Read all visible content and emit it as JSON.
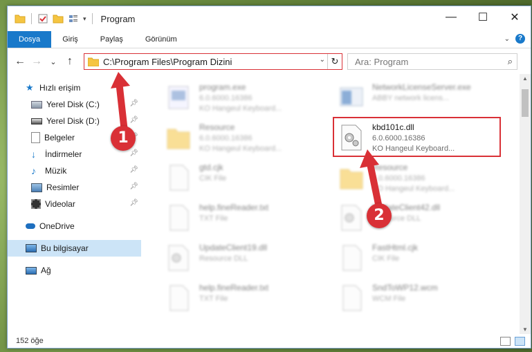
{
  "window": {
    "title": "Program",
    "controls": {
      "minimize": "—",
      "maximize": "☐",
      "close": "✕"
    }
  },
  "ribbon": {
    "tabs": [
      "Dosya",
      "Giriş",
      "Paylaş",
      "Görünüm"
    ]
  },
  "nav": {
    "back": "←",
    "forward": "→",
    "recent": "⌄",
    "up": "↑",
    "address": "C:\\Program Files\\Program Dizini",
    "search_placeholder": "Ara: Program"
  },
  "sidebar": {
    "quick_access": "Hızlı erişim",
    "items": [
      {
        "label": "Yerel Disk (C:)",
        "icon": "drive-icon"
      },
      {
        "label": "Yerel Disk (D:)",
        "icon": "drive-icon"
      },
      {
        "label": "Belgeler",
        "icon": "documents-icon"
      },
      {
        "label": "İndirmeler",
        "icon": "downloads-icon"
      },
      {
        "label": "Müzik",
        "icon": "music-icon"
      },
      {
        "label": "Resimler",
        "icon": "pictures-icon"
      },
      {
        "label": "Videolar",
        "icon": "videos-icon"
      }
    ],
    "onedrive": "OneDrive",
    "this_pc": "Bu bilgisayar",
    "network": "Ağ"
  },
  "files": [
    {
      "name": "program.exe",
      "line1": "6.0.6000.16386",
      "line2": "KO Hangeul Keyboard...",
      "icon": "exe-icon"
    },
    {
      "name": "NetworkLicenseServer.exe",
      "line1": "ABBY network licens...",
      "line2": "",
      "icon": "window-icon"
    },
    {
      "name": "Resource",
      "line1": "6.0.6000.16386",
      "line2": "KO Hangeul Keyboard...",
      "icon": "folder-icon"
    },
    {
      "name": "kbd101c.dll",
      "line1": "6.0.6000.16386",
      "line2": "KO Hangeul Keyboard...",
      "icon": "dll-gear-icon"
    },
    {
      "name": "gtd.cjk",
      "line1": "CIK File",
      "line2": "",
      "icon": "file-icon"
    },
    {
      "name": "Resource",
      "line1": "6.0.6000.16386",
      "line2": "KO Hangeul Keyboard...",
      "icon": "folder-icon"
    },
    {
      "name": "help.fineReader.txt",
      "line1": "TXT File",
      "line2": "",
      "icon": "file-icon"
    },
    {
      "name": "UpdateClient42.dll",
      "line1": "Resource DLL",
      "line2": "",
      "icon": "dll-gear-icon"
    },
    {
      "name": "UpdateClient19.dll",
      "line1": "Resource DLL",
      "line2": "",
      "icon": "dll-gear-icon"
    },
    {
      "name": "FastHtml.cjk",
      "line1": "CIK File",
      "line2": "",
      "icon": "file-icon"
    },
    {
      "name": "help.fineReader.txt",
      "line1": "TXT File",
      "line2": "",
      "icon": "file-icon"
    },
    {
      "name": "SndToWP12.wcm",
      "line1": "WCM File",
      "line2": "",
      "icon": "file-icon"
    }
  ],
  "callouts": [
    "1",
    "2"
  ],
  "status": {
    "count": "152 öğe"
  },
  "colors": {
    "accent": "#1979ca",
    "highlight": "#d93036",
    "selected": "#cce4f7"
  }
}
